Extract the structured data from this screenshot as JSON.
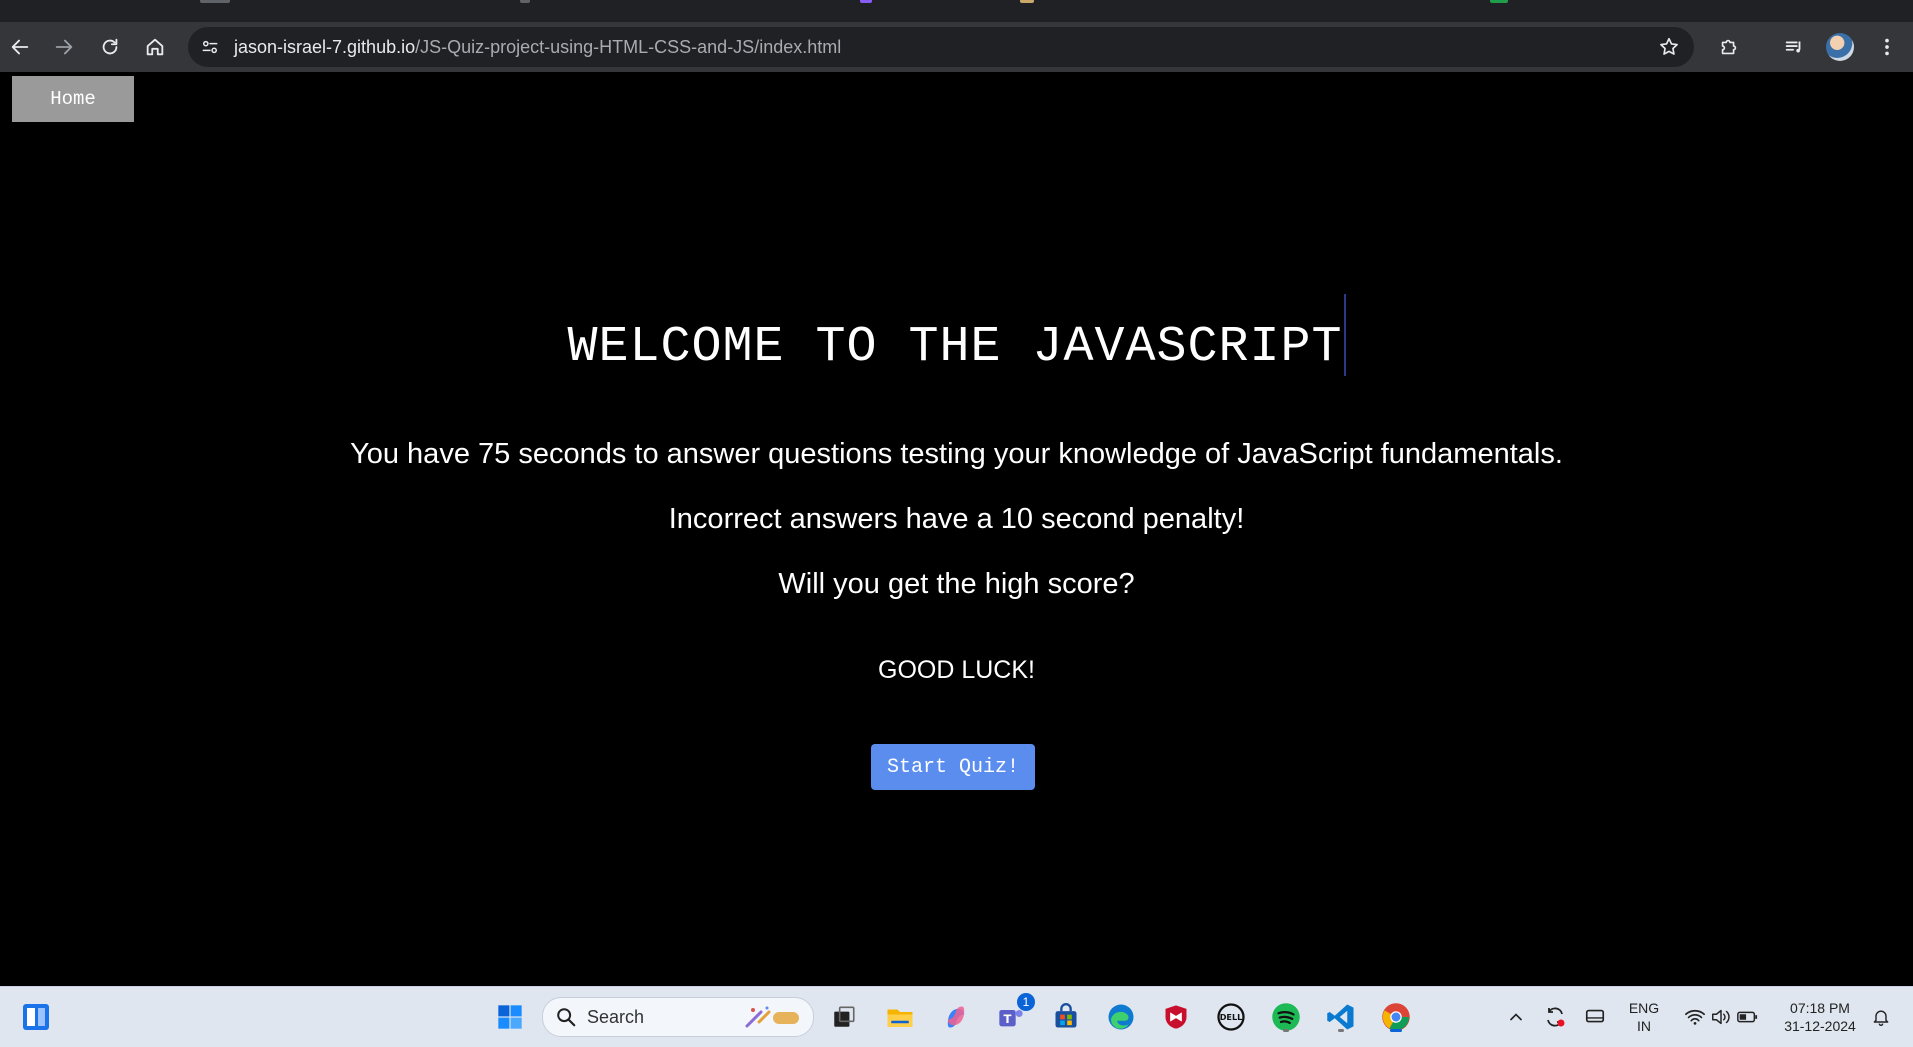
{
  "browser": {
    "url_host": "jason-israel-7.github.io",
    "url_path": "/JS-Quiz-project-using-HTML-CSS-and-JS/index.html"
  },
  "page": {
    "home_label": "Home",
    "welcome_title": "WELCOME TO THE JAVASCRIPT",
    "intro_line_1": "You have 75 seconds to answer questions testing your knowledge of JavaScript fundamentals.",
    "intro_line_2": "Incorrect answers have a 10 second penalty!",
    "intro_line_3": "Will you get the high score?",
    "good_luck": "GOOD LUCK!",
    "start_label": "Start Quiz!"
  },
  "taskbar": {
    "search_placeholder": "Search",
    "teams_badge": "1",
    "language_line_1": "ENG",
    "language_line_2": "IN",
    "time": "07:18 PM",
    "date": "31-12-2024"
  },
  "colors": {
    "page_background": "#000000",
    "start_button": "#5b8def",
    "home_button": "#9a9a9a",
    "browser_toolbar": "#35363a",
    "taskbar": "#dfe6f0"
  }
}
